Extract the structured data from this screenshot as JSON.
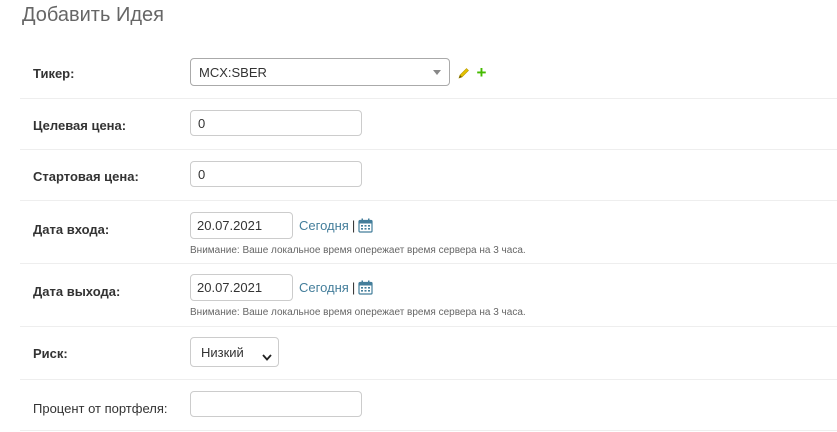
{
  "page": {
    "title": "Добавить Идея"
  },
  "fields": {
    "ticker": {
      "label": "Тикер:",
      "value": "MCX:SBER"
    },
    "target_price": {
      "label": "Целевая цена:",
      "value": "0"
    },
    "start_price": {
      "label": "Стартовая цена:",
      "value": "0"
    },
    "entry_date": {
      "label": "Дата входа:",
      "value": "20.07.2021",
      "today_label": "Сегодня",
      "separator": "|",
      "help": "Внимание: Ваше локальное время опережает время сервера на 3 часа."
    },
    "exit_date": {
      "label": "Дата выхода:",
      "value": "20.07.2021",
      "today_label": "Сегодня",
      "separator": "|",
      "help": "Внимание: Ваше локальное время опережает время сервера на 3 часа."
    },
    "risk": {
      "label": "Риск:",
      "value": "Низкий"
    },
    "portfolio_percent": {
      "label": "Процент от портфеля:",
      "value": ""
    }
  },
  "icons": {
    "edit": "pencil-icon",
    "add": "plus-icon",
    "calendar": "calendar-icon",
    "select_arrow": "chevron-down-icon"
  },
  "colors": {
    "link": "#447e9b",
    "add_icon": "#44bb00",
    "edit_icon": "#e5c100"
  }
}
